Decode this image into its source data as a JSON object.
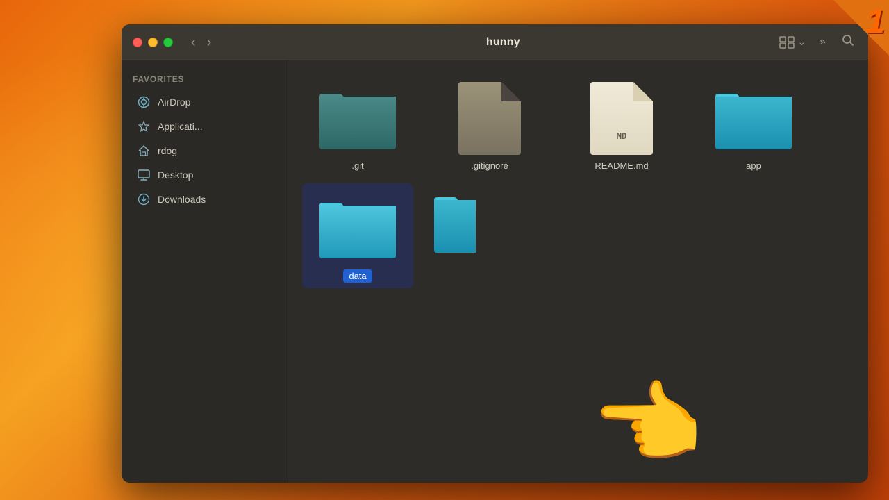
{
  "window": {
    "title": "hunny",
    "traffic_lights": {
      "close": "close",
      "minimize": "minimize",
      "maximize": "maximize"
    },
    "nav": {
      "back_label": "‹",
      "forward_label": "›",
      "back_aria": "Back",
      "forward_aria": "Forward"
    },
    "toolbar": {
      "view_grid_label": "⊞",
      "view_chevron_label": "⌃",
      "more_label": "»",
      "search_label": "⌕"
    }
  },
  "sidebar": {
    "section_title": "Favorites",
    "items": [
      {
        "id": "airdrop",
        "label": "AirDrop",
        "icon": "airdrop"
      },
      {
        "id": "applications",
        "label": "Applicati...",
        "icon": "applications"
      },
      {
        "id": "rdog",
        "label": "rdog",
        "icon": "home"
      },
      {
        "id": "desktop",
        "label": "Desktop",
        "icon": "desktop"
      },
      {
        "id": "downloads",
        "label": "Downloads",
        "icon": "downloads"
      }
    ]
  },
  "files": [
    {
      "id": "git",
      "name": ".git",
      "type": "folder-teal",
      "row": 1
    },
    {
      "id": "gitignore",
      "name": ".gitignore",
      "type": "doc-gitignore",
      "row": 1
    },
    {
      "id": "readme",
      "name": "README.md",
      "type": "doc-readme",
      "row": 1
    },
    {
      "id": "app",
      "name": "app",
      "type": "folder-blue",
      "row": 1
    },
    {
      "id": "data",
      "name": "data",
      "type": "folder-blue-selected",
      "row": 2,
      "selected": true
    }
  ],
  "corner_badge": {
    "number": "1"
  }
}
